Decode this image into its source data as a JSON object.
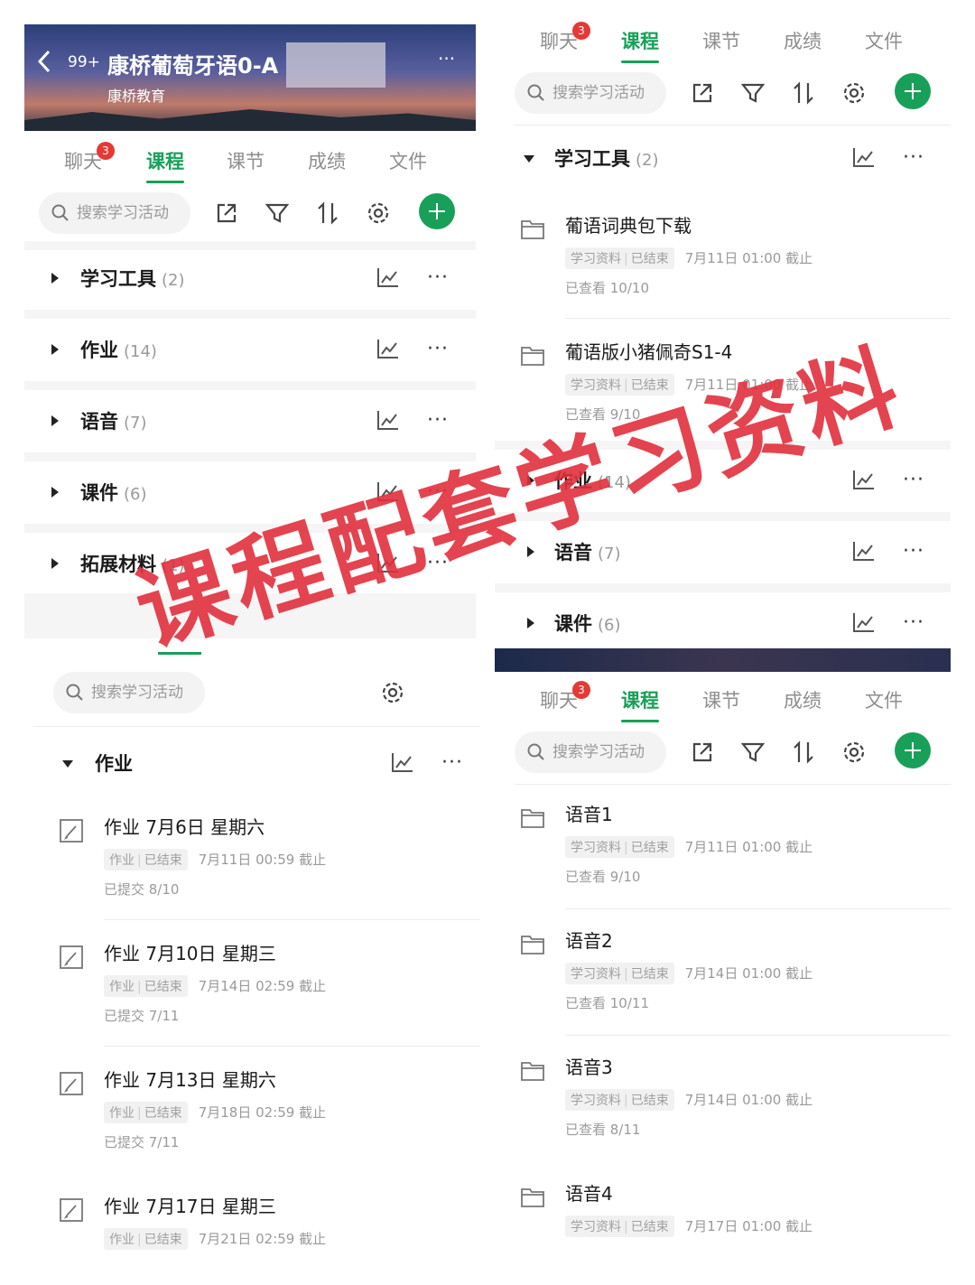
{
  "header": {
    "back_badge": "99+",
    "title": "康桥葡萄牙语0-A",
    "subtitle": "康桥教育",
    "more": "···"
  },
  "tabs": {
    "chat": "聊天",
    "chat_badge": "3",
    "course": "课程",
    "lesson": "课节",
    "grades": "成绩",
    "files": "文件"
  },
  "search_placeholder": "搜索学习活动",
  "more": "···",
  "categories": {
    "tools": {
      "name": "学习工具",
      "count": "(2)"
    },
    "homework": {
      "name": "作业",
      "count": "(14)"
    },
    "audio": {
      "name": "语音",
      "count": "(7)"
    },
    "courseware": {
      "name": "课件",
      "count": "(6)"
    },
    "extension": {
      "name": "拓展材料",
      "count": "(1)"
    }
  },
  "tag_material": "学习资料",
  "tag_homework": "作业",
  "tag_ended": "已结束",
  "homework_items": [
    {
      "title": "作业 7月6日 星期六",
      "deadline": "7月11日 00:59 截止",
      "status": "已提交 8/10"
    },
    {
      "title": "作业 7月10日 星期三",
      "deadline": "7月14日 02:59 截止",
      "status": "已提交 7/11"
    },
    {
      "title": "作业 7月13日 星期六",
      "deadline": "7月18日 02:59 截止",
      "status": "已提交 7/11"
    },
    {
      "title": "作业 7月17日 星期三",
      "deadline": "7月21日 02:59 截止"
    }
  ],
  "tool_items": [
    {
      "title": "葡语词典包下载",
      "deadline": "7月11日 01:00 截止",
      "status": "已查看 10/10"
    },
    {
      "title": "葡语版小猪佩奇S1-4",
      "deadline": "7月11日 01:00 截止",
      "status": "已查看 9/10"
    }
  ],
  "audio_items": [
    {
      "title": "语音1",
      "deadline": "7月11日 01:00 截止",
      "status": "已查看 9/10"
    },
    {
      "title": "语音2",
      "deadline": "7月14日 01:00 截止",
      "status": "已查看 10/11"
    },
    {
      "title": "语音3",
      "deadline": "7月14日 01:00 截止",
      "status": "已查看 8/11"
    },
    {
      "title": "语音4",
      "deadline": "7月17日 01:00 截止"
    }
  ],
  "watermark": "课程配套学习资料",
  "colors": {
    "accent": "#18a058",
    "badge": "#e53935",
    "watermark": "#e0303c"
  }
}
